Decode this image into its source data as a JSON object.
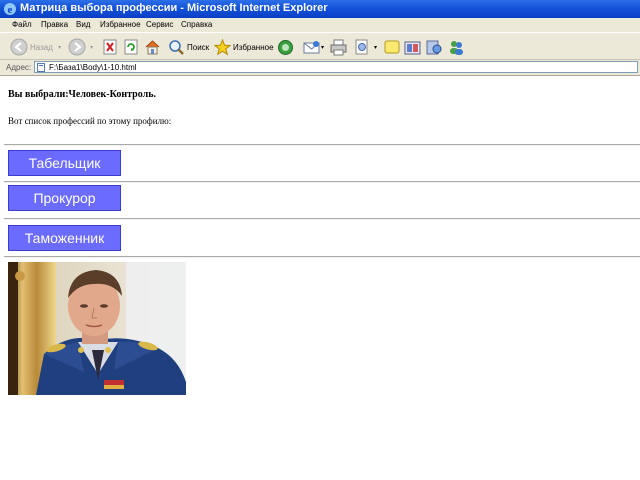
{
  "window": {
    "title": "Матрица выбора профессии - Microsoft Internet Explorer"
  },
  "menu": [
    "Файл",
    "Правка",
    "Вид",
    "Избранное",
    "Сервис",
    "Справка"
  ],
  "toolbar": {
    "back_label": "Назад",
    "search_label": "Поиск",
    "favorites_label": "Избранное"
  },
  "address": {
    "label": "Адрес:",
    "url": "F:\\База1\\Body\\1-10.html"
  },
  "content": {
    "chosen_text": "Вы выбрали:Человек-Контроль.",
    "list_intro": "Вот список профессий по этому профилю:",
    "professions": [
      "Табельщик",
      "Прокурор",
      "Таможенник"
    ]
  },
  "colors": {
    "button_bg": "#6b6bff",
    "titlebar": "#0a3fc6"
  }
}
